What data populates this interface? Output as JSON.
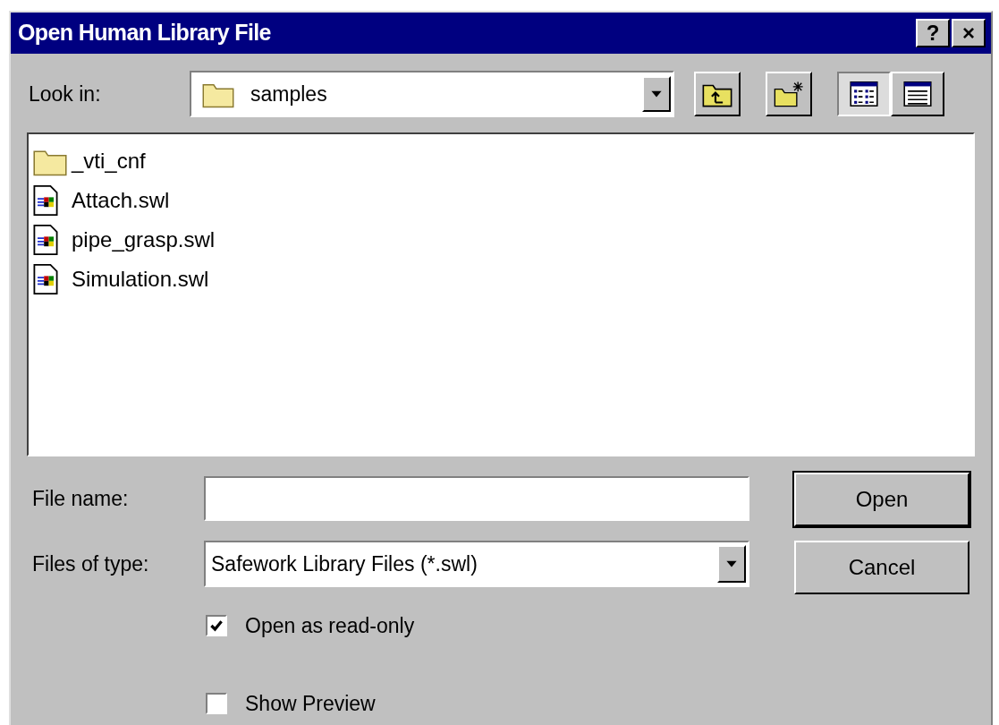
{
  "window": {
    "title": "Open Human Library File",
    "title_buttons": [
      "?",
      "×"
    ]
  },
  "look_in": {
    "label": "Look in:",
    "value": "samples"
  },
  "view_buttons": [
    {
      "kind": "list",
      "selected": true
    },
    {
      "kind": "details",
      "selected": false
    }
  ],
  "files": [
    {
      "kind": "folder",
      "name": "_vti_cnf"
    },
    {
      "kind": "file",
      "name": "Attach.swl"
    },
    {
      "kind": "file",
      "name": "pipe_grasp.swl"
    },
    {
      "kind": "file",
      "name": "Simulation.swl"
    }
  ],
  "file_name": {
    "label": "File name:"
  },
  "file_type": {
    "label": "Files of type:",
    "value": "Safework Library Files (*.swl)"
  },
  "buttons": [
    {
      "label": "Open",
      "default": true
    },
    {
      "label": "Cancel",
      "default": false
    }
  ],
  "checkboxes": [
    {
      "label": "Open as read-only",
      "checked": true
    },
    {
      "label": "Show Preview",
      "checked": false
    }
  ]
}
